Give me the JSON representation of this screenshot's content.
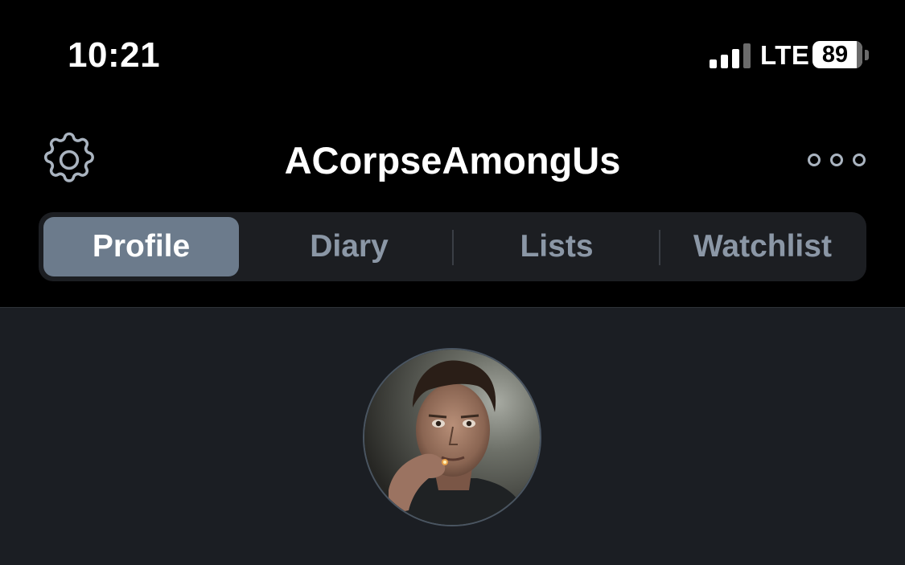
{
  "status_bar": {
    "time": "10:21",
    "network": "LTE",
    "battery_level": "89"
  },
  "header": {
    "title": "ACorpseAmongUs",
    "left_icon": "gear-icon",
    "right_icon": "more-icon"
  },
  "tabs": [
    {
      "label": "Profile",
      "active": true
    },
    {
      "label": "Diary",
      "active": false
    },
    {
      "label": "Lists",
      "active": false
    },
    {
      "label": "Watchlist",
      "active": false
    }
  ],
  "profile": {
    "avatar_icon": "avatar"
  },
  "colors": {
    "background": "#000000",
    "content_background": "#1b1e23",
    "segmented_background": "#1c1e22",
    "active_tab": "#6c7b8c",
    "inactive_tab_text": "#8b97a6"
  }
}
